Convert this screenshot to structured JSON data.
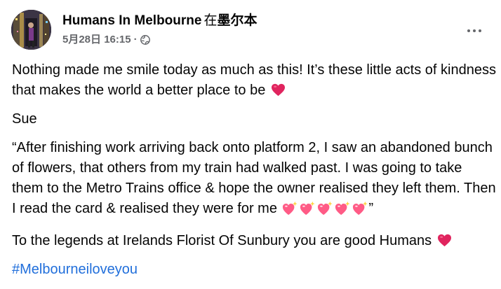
{
  "post": {
    "page_name": "Humans In Melbourne",
    "in_text": "在",
    "location": "墨尔本",
    "timestamp": "5月28日 16:15",
    "separator": "·",
    "audience_icon": "globe-icon",
    "more_icon": "more-dots-icon",
    "paragraphs": {
      "p1": "Nothing made me smile today as much as this! It’s these little acts of kindness that makes the world a better place to be",
      "p2": "Sue",
      "p3": "“After finishing work arriving back onto platform 2, I saw an abandoned bunch of flowers, that others from my train had walked past. I was going to take them to the Metro Trains office & hope the owner realised they left them. Then I read the card & realised they were for me",
      "p3_end": "”",
      "p4": "To the legends at Irelands Florist Of Sunbury you are good Humans"
    },
    "hashtag": "#Melbourneiloveyou",
    "sparkle_heart_count": 5
  },
  "colors": {
    "text": "#050505",
    "meta": "#65676b",
    "link": "#216fdb",
    "heart": "#e0245e",
    "sparkle_heart": "#ff5b86"
  }
}
